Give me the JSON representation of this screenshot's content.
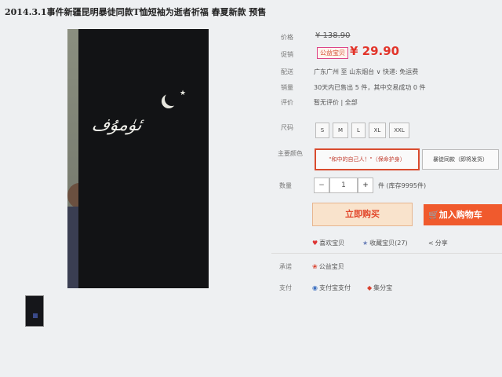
{
  "product": {
    "title": "2014.3.1事件新疆昆明暴徒同款T恤短袖为逝者祈福 春夏新款 预售"
  },
  "price": {
    "label": "价格",
    "original": "¥ 138.90"
  },
  "promo": {
    "label": "促销",
    "tag": "公益宝贝",
    "price": "¥ 29.90"
  },
  "shipping": {
    "label": "配送",
    "text": "广东广州 至  山东烟台 ∨   快递: 免运费"
  },
  "sales": {
    "label": "销量",
    "text": "30天内已售出 5 件，其中交易成功 0 件"
  },
  "rating": {
    "label": "评价",
    "text": "暂无评价 | 全部"
  },
  "size": {
    "label": "尺码",
    "options": [
      "S",
      "M",
      "L",
      "XL",
      "XXL"
    ]
  },
  "color": {
    "label": "主要颜色",
    "options": [
      "\"和中的自己人！\"（保命护身）",
      "暴徒同款（即将发货）"
    ]
  },
  "quantity": {
    "label": "数量",
    "minus": "−",
    "value": "1",
    "plus": "+",
    "stock": "件 (库存9995件)"
  },
  "actions": {
    "buy_now": "立即购买",
    "add_to_cart": "加入购物车"
  },
  "social": {
    "like": "喜欢宝贝",
    "favorite": "收藏宝贝(27)",
    "share": "分享"
  },
  "commitment": {
    "label": "承诺",
    "item": "公益宝贝"
  },
  "payment": {
    "label": "支付",
    "methods": [
      "支付宝支付",
      "集分宝"
    ]
  },
  "colors": {
    "price_red": "#e2342a",
    "cart_orange": "#f05a2d",
    "buy_bg": "#f9e3cc"
  }
}
